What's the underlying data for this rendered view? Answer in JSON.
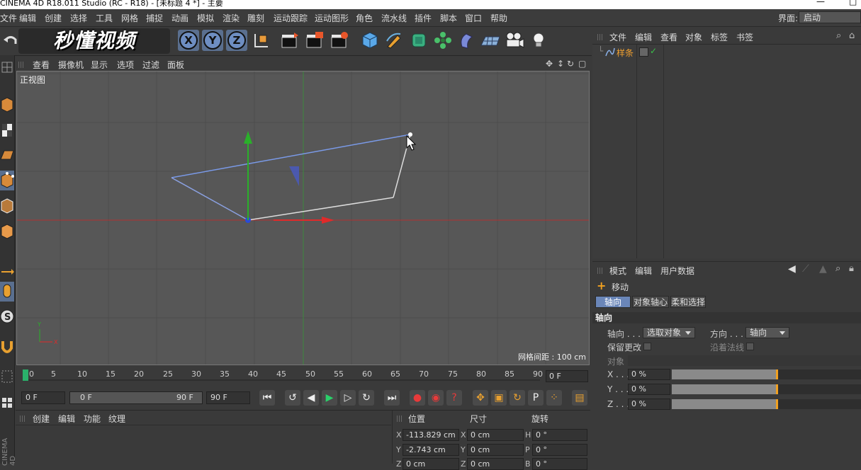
{
  "title_bar": {
    "text": "CINEMA 4D R18.011 Studio (RC - R18) - [未标题 4 *] - 主要",
    "minimize": "—",
    "maximize": "□"
  },
  "menubar": {
    "items": [
      "文件",
      "编辑",
      "创建",
      "选择",
      "工具",
      "网格",
      "捕捉",
      "动画",
      "模拟",
      "渲染",
      "雕刻",
      "运动跟踪",
      "运动图形",
      "角色",
      "流水线",
      "插件",
      "脚本",
      "窗口",
      "帮助"
    ],
    "layout_label": "界面:",
    "layout_value": "启动"
  },
  "toolbar": {
    "logo_text": "秒懂视频",
    "axis_x": "X",
    "axis_y": "Y",
    "axis_z": "Z"
  },
  "viewport": {
    "menu": [
      "查看",
      "摄像机",
      "显示",
      "选项",
      "过滤",
      "面板"
    ],
    "view_name": "正视图",
    "grid_spacing": "网格间距 : 100 cm"
  },
  "timeline": {
    "ticks": [
      "0",
      "5",
      "10",
      "15",
      "20",
      "25",
      "30",
      "35",
      "40",
      "45",
      "50",
      "55",
      "60",
      "65",
      "70",
      "75",
      "80",
      "85",
      "90"
    ],
    "current_frame": "0 F"
  },
  "transport": {
    "start_field": "0 F",
    "range_start": "0 F",
    "range_end": "90 F",
    "end_field": "90 F"
  },
  "material_manager": {
    "menu": [
      "创建",
      "编辑",
      "功能",
      "纹理"
    ]
  },
  "coordinates": {
    "headers": {
      "position": "位置",
      "size": "尺寸",
      "rotation": "旋转"
    },
    "rows": [
      {
        "axis": "X",
        "pos": "-113.829 cm",
        "size_axis": "X",
        "size": "0 cm",
        "rot_axis": "H",
        "rot": "0 °"
      },
      {
        "axis": "Y",
        "pos": "-2.743 cm",
        "size_axis": "Y",
        "size": "0 cm",
        "rot_axis": "P",
        "rot": "0 °"
      },
      {
        "axis": "Z",
        "pos": "0 cm",
        "size_axis": "Z",
        "size": "0 cm",
        "rot_axis": "B",
        "rot": "0 °"
      }
    ]
  },
  "object_manager": {
    "menu": [
      "文件",
      "编辑",
      "查看",
      "对象",
      "标签",
      "书签"
    ],
    "objects": [
      {
        "name": "样条"
      }
    ]
  },
  "attribute_manager": {
    "menu": [
      "模式",
      "编辑",
      "用户数据"
    ],
    "tool_name": "移动",
    "tabs": [
      "轴向",
      "对象轴心",
      "柔和选择"
    ],
    "section": "轴向",
    "axis_label": "轴向 . . . .",
    "axis_value": "选取对象",
    "direction_label": "方向 . . . .",
    "direction_value": "轴向",
    "keep_changes": "保留更改",
    "along_normals": "沿着法线",
    "object_label": "对象",
    "sliders": [
      {
        "label": "X . . .",
        "value": "0 %",
        "fill": 0.55
      },
      {
        "label": "Y . . .",
        "value": "0 %",
        "fill": 0.55
      },
      {
        "label": "Z . . .",
        "value": "0 %",
        "fill": 0.55
      }
    ]
  },
  "side_label": "CINEMA 4D"
}
